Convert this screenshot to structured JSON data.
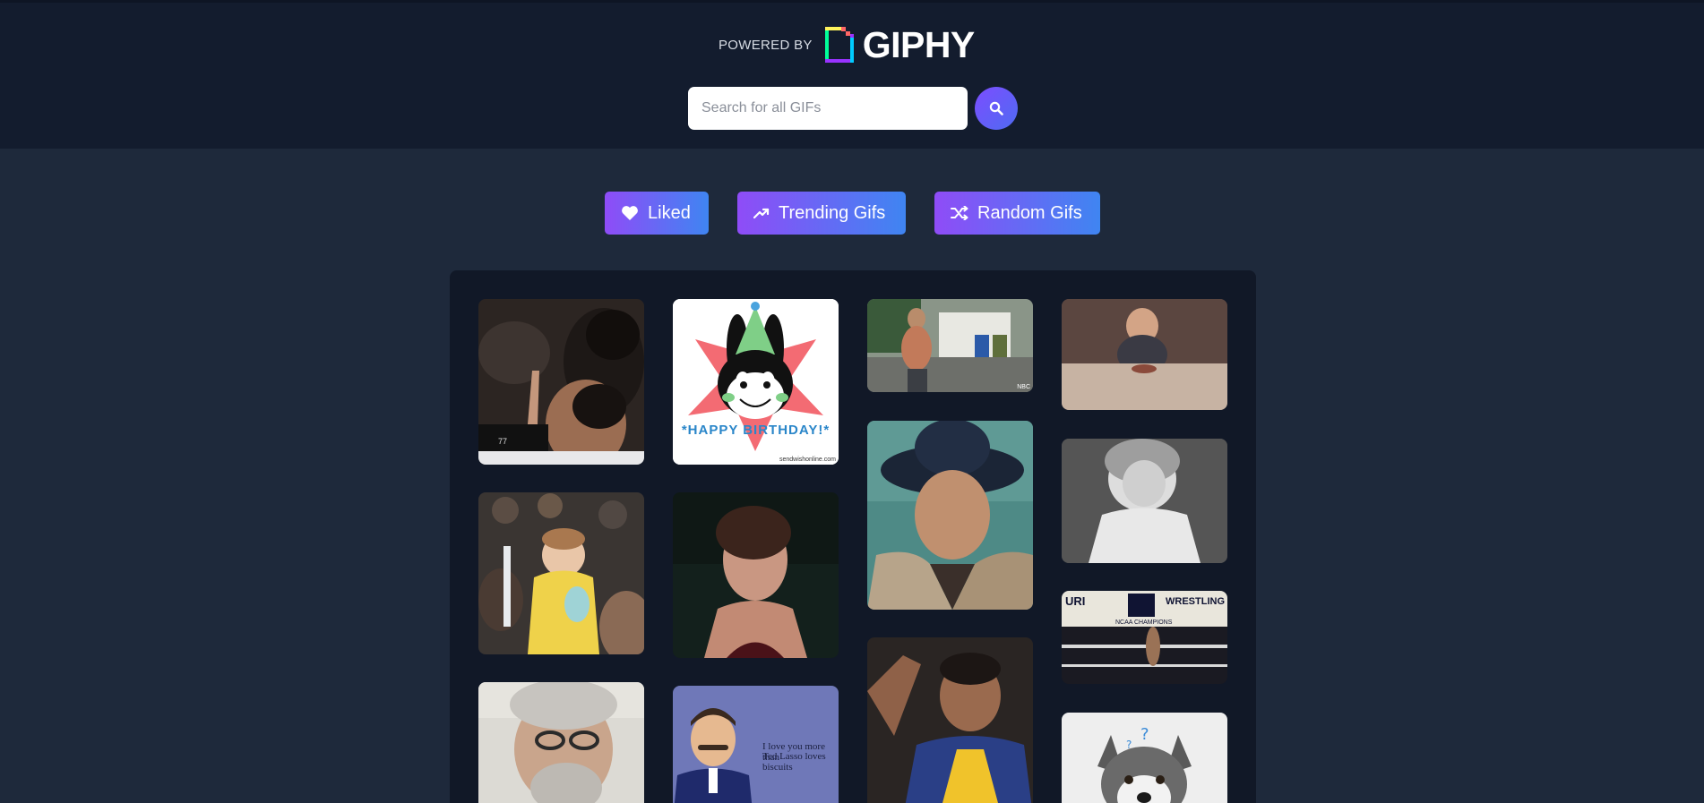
{
  "header": {
    "powered_by": "POWERED BY",
    "brand": "GIPHY",
    "brand_colors": [
      "#00ff99",
      "#00ccff",
      "#9933ff",
      "#ff6666",
      "#fff35c"
    ]
  },
  "search": {
    "placeholder": "Search for all GIFs",
    "value": "",
    "button_icon": "search-icon"
  },
  "nav": [
    {
      "label": "Liked",
      "icon": "heart-icon"
    },
    {
      "label": "Trending Gifs",
      "icon": "trending-up-icon"
    },
    {
      "label": "Random Gifs",
      "icon": "shuffle-icon"
    }
  ],
  "gifs": {
    "basketball_score": "77",
    "birthday_text": "*HAPPY BIRTHDAY!*",
    "birthday_watermark": "sendwishonline.com",
    "ted_lasso_caption_line1": "I love you more than",
    "ted_lasso_caption_line2": "Ted Lasso loves biscuits",
    "wrestling_text_left": "URI",
    "wrestling_text_right": "WRESTLING",
    "wrestling_champs": "NCAA CHAMPIONS",
    "nbc_badge": "NBC"
  },
  "colors": {
    "header_bg": "#131c2e",
    "page_bg": "#1e293b",
    "grid_bg": "#111827",
    "button_gradient_start": "#8f4cf7",
    "button_gradient_end": "#3f85f2"
  }
}
